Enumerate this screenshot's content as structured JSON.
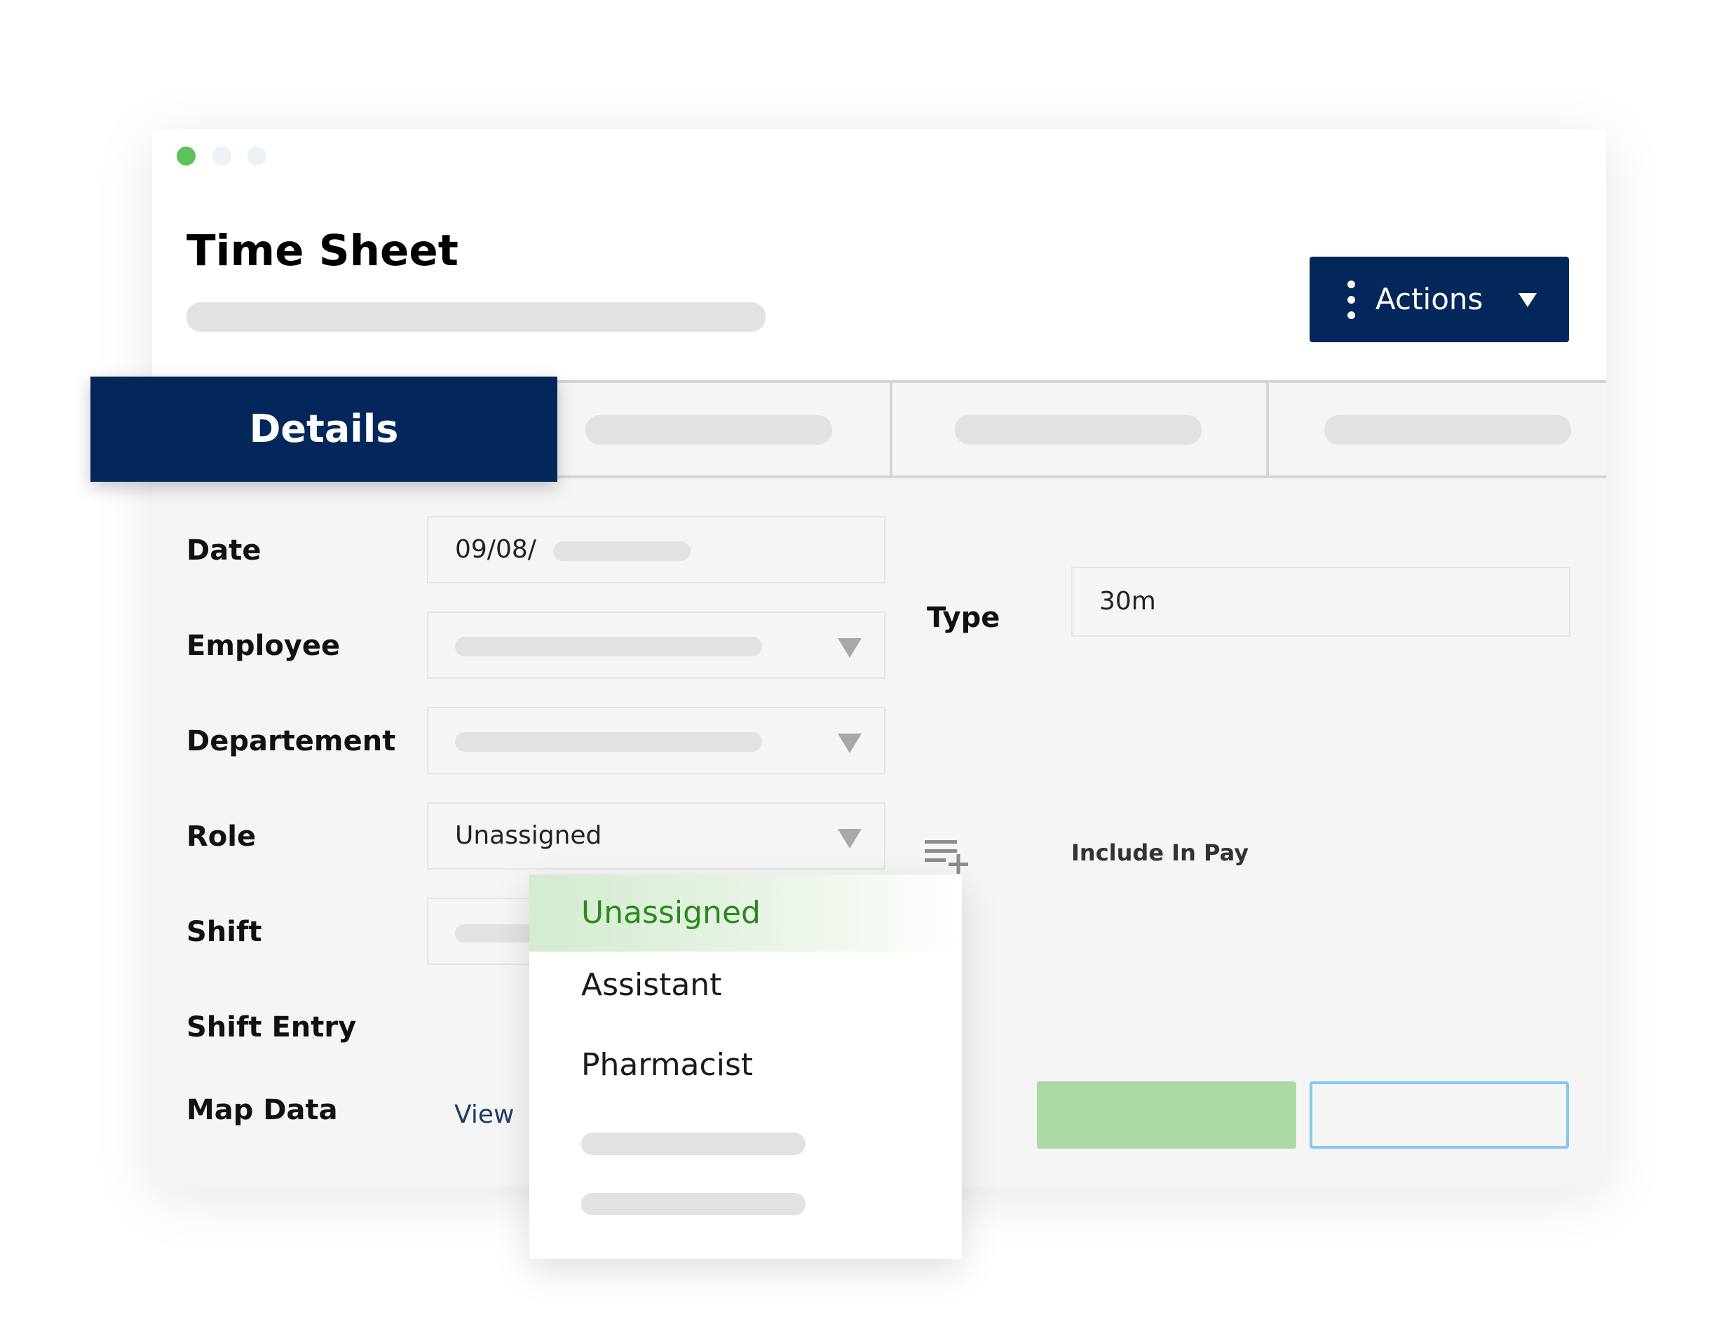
{
  "window": {
    "title": "Time Sheet",
    "actions_label": "Actions"
  },
  "tabs": {
    "active_label": "Details"
  },
  "form": {
    "date": {
      "label": "Date",
      "value_prefix": "09/08/"
    },
    "employee": {
      "label": "Employee"
    },
    "department": {
      "label": "Departement"
    },
    "role": {
      "label": "Role",
      "value": "Unassigned"
    },
    "shift": {
      "label": "Shift"
    },
    "shift_entry": {
      "label": "Shift Entry"
    },
    "map_data": {
      "label": "Map Data",
      "link": "View"
    },
    "type": {
      "label": "Type",
      "value": "30m"
    },
    "include_in_pay": {
      "label": "Include In Pay"
    }
  },
  "role_dropdown": {
    "options": [
      "Unassigned",
      "Assistant",
      "Pharmacist"
    ],
    "selected": "Unassigned"
  },
  "colors": {
    "primary_navy": "#03275a",
    "accent_green": "#5cc25a",
    "selected_text_green": "#2b8a1e",
    "save_button_green": "#abd9a4",
    "outline_button_blue": "#86c9ee"
  },
  "icons": {
    "window_controls": [
      "window-dot-green-icon",
      "window-dot-gray-icon",
      "window-dot-gray-icon"
    ],
    "actions": [
      "kebab-menu-icon",
      "caret-down-icon"
    ],
    "selects": "chevron-down-icon",
    "list_add": "playlist-add-icon"
  }
}
